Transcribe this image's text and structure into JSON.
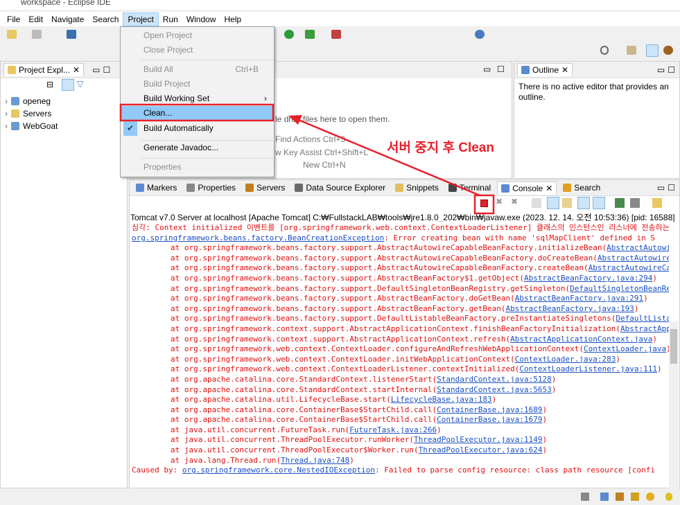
{
  "window": {
    "title": "workspace - Eclipse IDE"
  },
  "menubar": [
    "File",
    "Edit",
    "Navigate",
    "Search",
    "Project",
    "Run",
    "Window",
    "Help"
  ],
  "project_menu": {
    "items": [
      {
        "label": "Open Project",
        "enabled": false
      },
      {
        "label": "Close Project",
        "enabled": false
      },
      {
        "label": "Build All",
        "shortcut": "Ctrl+B",
        "enabled": false
      },
      {
        "label": "Build Project",
        "enabled": false
      },
      {
        "label": "Build Working Set",
        "submenu": true,
        "enabled": true
      },
      {
        "label": "Clean...",
        "enabled": true,
        "highlighted": true
      },
      {
        "label": "Build Automatically",
        "checked": true,
        "enabled": true
      },
      {
        "label": "Generate Javadoc...",
        "enabled": true
      },
      {
        "label": "Properties",
        "enabled": false
      }
    ]
  },
  "project_explorer": {
    "title": "Project Expl...",
    "items": [
      "openeg",
      "Servers",
      "WebGoat"
    ]
  },
  "editor": {
    "hints": [
      "drop files here to open them.",
      "Find Actions Ctrl+3",
      "w Key Assist Ctrl+Shift+L",
      "New Ctrl+N"
    ],
    "hint_prefix": "le"
  },
  "outline": {
    "title": "Outline",
    "message": "There is no active editor that provides an outline."
  },
  "bottom_tabs": [
    "Markers",
    "Properties",
    "Servers",
    "Data Source Explorer",
    "Snippets",
    "Terminal",
    "Console",
    "Search"
  ],
  "console": {
    "header": "Tomcat v7.0 Server at localhost [Apache Tomcat] C:₩FullstackLAB₩tools₩jre1.8.0_202₩bin₩javaw.exe  (2023. 12. 14. 오전 10:53:36) [pid: 16588]",
    "line1": "심각: Context initialized 이벤트를 [org.springframework.web.context.ContextLoaderListener] 클래스의 인스턴스인 리스너에 전송하는",
    "exception_link": "org.springframework.beans.factory.BeanCreationException",
    "exception_msg": ": Error creating bean with name 'sqlMapClient' defined in S",
    "stack": [
      [
        "org.springframework.beans.factory.support.AbstractAutowireCapableBeanFactory.initializeBean(",
        "AbstractAutowireCapableBeanFactory.java"
      ],
      [
        "org.springframework.beans.factory.support.AbstractAutowireCapableBeanFactory.doCreateBean(",
        "AbstractAutowireCapableBeanFactory.java"
      ],
      [
        "org.springframework.beans.factory.support.AbstractAutowireCapableBeanFactory.createBean(",
        "AbstractAutowireCapableBeanFactory.java"
      ],
      [
        "org.springframework.beans.factory.support.AbstractBeanFactory$1.getObject(",
        "AbstractBeanFactory.java:294"
      ],
      [
        "org.springframework.beans.factory.support.DefaultSingletonBeanRegistry.getSingleton(",
        "DefaultSingletonBeanRegistry.java"
      ],
      [
        "org.springframework.beans.factory.support.AbstractBeanFactory.doGetBean(",
        "AbstractBeanFactory.java:291"
      ],
      [
        "org.springframework.beans.factory.support.AbstractBeanFactory.getBean(",
        "AbstractBeanFactory.java:193"
      ],
      [
        "org.springframework.beans.factory.support.DefaultListableBeanFactory.preInstantiateSingletons(",
        "DefaultListableBeanFactory.java"
      ],
      [
        "org.springframework.context.support.AbstractApplicationContext.finishBeanFactoryInitialization(",
        "AbstractApplicationContext.java"
      ],
      [
        "org.springframework.context.support.AbstractApplicationContext.refresh(",
        "AbstractApplicationContext.java"
      ],
      [
        "org.springframework.web.context.ContextLoader.configureAndRefreshWebApplicationContext(",
        "ContextLoader.java"
      ],
      [
        "org.springframework.web.context.ContextLoader.initWebApplicationContext(",
        "ContextLoader.java:283"
      ],
      [
        "org.springframework.web.context.ContextLoaderListener.contextInitialized(",
        "ContextLoaderListener.java:111"
      ],
      [
        "org.apache.catalina.core.StandardContext.listenerStart(",
        "StandardContext.java:5128"
      ],
      [
        "org.apache.catalina.core.StandardContext.startInternal(",
        "StandardContext.java:5653"
      ],
      [
        "org.apache.catalina.util.LifecycleBase.start(",
        "LifecycleBase.java:183"
      ],
      [
        "org.apache.catalina.core.ContainerBase$StartChild.call(",
        "ContainerBase.java:1689"
      ],
      [
        "org.apache.catalina.core.ContainerBase$StartChild.call(",
        "ContainerBase.java:1679"
      ],
      [
        "java.util.concurrent.FutureTask.run(",
        "FutureTask.java:266"
      ],
      [
        "java.util.concurrent.ThreadPoolExecutor.runWorker(",
        "ThreadPoolExecutor.java:1149"
      ],
      [
        "java.util.concurrent.ThreadPoolExecutor$Worker.run(",
        "ThreadPoolExecutor.java:624"
      ],
      [
        "java.lang.Thread.run(",
        "Thread.java:748"
      ]
    ],
    "caused_by": "Caused by: ",
    "caused_link": "org.springframework.core.NestedIOException",
    "caused_msg": ": Failed to parse config resource: class path resource [confi"
  },
  "annotation": {
    "text": "서버 중지 후 Clean",
    "color": "#e8202a"
  }
}
